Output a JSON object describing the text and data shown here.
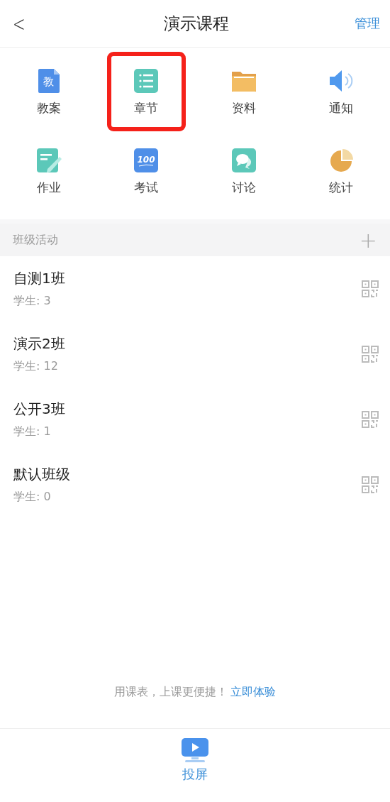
{
  "header": {
    "back": "<",
    "title": "演示课程",
    "action": "管理"
  },
  "features": [
    {
      "kind": "lesson",
      "label": "教案",
      "icon_text": "教",
      "highlighted": false
    },
    {
      "kind": "chapter",
      "label": "章节",
      "highlighted": true
    },
    {
      "kind": "folder",
      "label": "资料",
      "highlighted": false
    },
    {
      "kind": "notice",
      "label": "通知",
      "highlighted": false
    },
    {
      "kind": "homework",
      "label": "作业",
      "highlighted": false
    },
    {
      "kind": "exam",
      "label": "考试",
      "icon_text": "100",
      "highlighted": false
    },
    {
      "kind": "discussion",
      "label": "讨论",
      "highlighted": false
    },
    {
      "kind": "stats",
      "label": "统计",
      "highlighted": false
    }
  ],
  "section": {
    "title": "班级活动",
    "add": "+"
  },
  "classes": [
    {
      "name": "自测1班",
      "students": "学生: 3"
    },
    {
      "name": "演示2班",
      "students": "学生: 12"
    },
    {
      "name": "公开3班",
      "students": "学生: 1"
    },
    {
      "name": "默认班级",
      "students": "学生: 0"
    }
  ],
  "promo": {
    "text": "用课表，上课更便捷！",
    "link": "立即体验"
  },
  "bottom_tab": {
    "label": "投屏"
  }
}
